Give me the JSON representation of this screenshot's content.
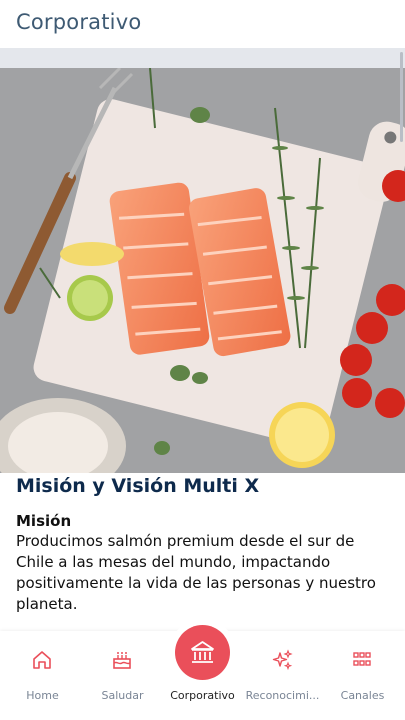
{
  "header": {
    "title": "Corporativo"
  },
  "section": {
    "title": "Misión y Visión Multi X",
    "subtitle": "Misión",
    "paragraph": "Producimos salmón premium desde el sur de Chile a las mesas del mundo, impactando positivamente la vida de las personas y nuestro planeta."
  },
  "nav": {
    "items": [
      {
        "label": "Home",
        "icon": "home-icon"
      },
      {
        "label": "Saludar",
        "icon": "cake-icon"
      },
      {
        "label": "Corporativo",
        "icon": "bank-icon"
      },
      {
        "label": "Reconocimi...",
        "icon": "sparkle-icon"
      },
      {
        "label": "Canales",
        "icon": "grid-icon"
      }
    ]
  },
  "colors": {
    "accent": "#ea4f5a",
    "title": "#0e2a4c",
    "header": "#3e5a73"
  }
}
